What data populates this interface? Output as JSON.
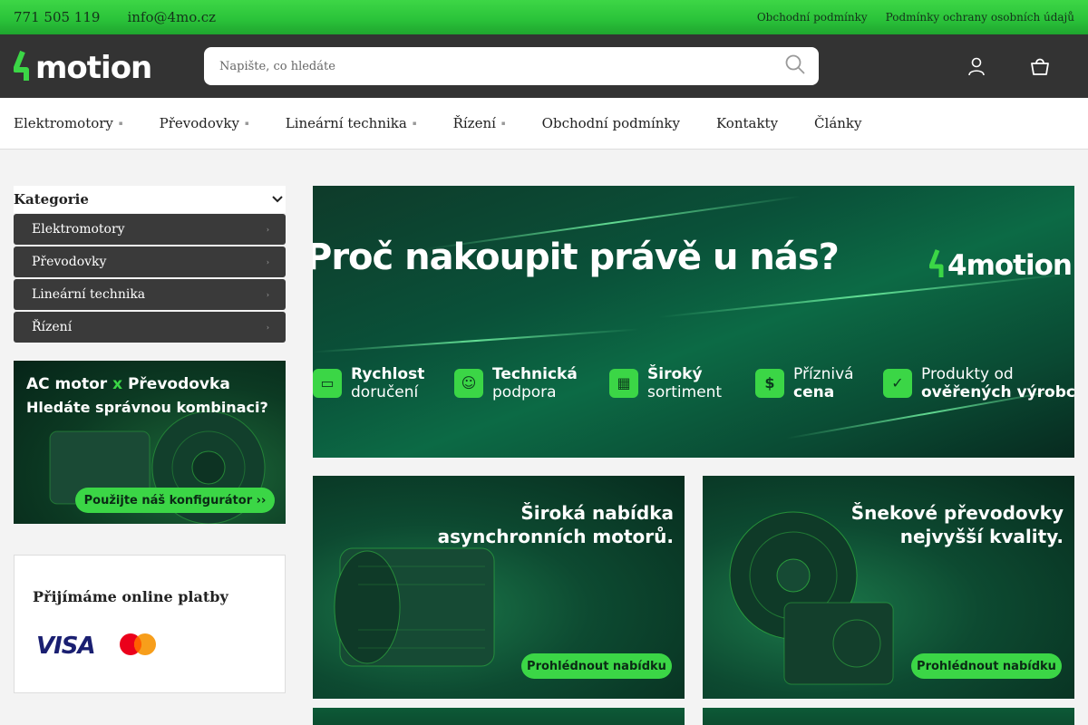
{
  "topbar": {
    "phone": "771 505 119",
    "email": "info@4mo.cz",
    "links": [
      "Obchodní podmínky",
      "Podmínky ochrany osobních údajů"
    ]
  },
  "header": {
    "logo_text": "4motion",
    "search": {
      "placeholder": "Napište, co hledáte",
      "icon": "search-icon"
    },
    "icons": [
      "user-icon",
      "cart-icon"
    ]
  },
  "nav": {
    "items": [
      {
        "label": "Elektromotory",
        "has_submenu": true
      },
      {
        "label": "Převodovky",
        "has_submenu": true
      },
      {
        "label": "Lineární technika",
        "has_submenu": true
      },
      {
        "label": "Řízení",
        "has_submenu": true
      },
      {
        "label": "Obchodní podmínky",
        "has_submenu": false
      },
      {
        "label": "Kontakty",
        "has_submenu": false
      },
      {
        "label": "Články",
        "has_submenu": false
      }
    ]
  },
  "sidebar": {
    "categories_title": "Kategorie",
    "categories": [
      {
        "label": "Elektromotory"
      },
      {
        "label": "Převodovky"
      },
      {
        "label": "Lineární technika"
      },
      {
        "label": "Řízení"
      }
    ],
    "configurator_banner": {
      "title_a": "AC motor",
      "title_x": "x",
      "title_b": "Převodovka",
      "subtitle": "Hledáte správnou kombinaci?",
      "button": "Použijte náš konfigurátor ››"
    },
    "payments": {
      "title": "Přijímáme online platby",
      "visa": "VISA"
    }
  },
  "hero": {
    "title": "Proč nakoupit právě u nás?",
    "logo_text": "4motion",
    "features": [
      {
        "line1": "Rychlost",
        "line2": "doručení",
        "bold": "line1",
        "icon": "truck-icon"
      },
      {
        "line1": "Technická",
        "line2": "podpora",
        "bold": "line1",
        "icon": "support-icon"
      },
      {
        "line1": "Široký",
        "line2": "sortiment",
        "bold": "line1",
        "icon": "boxes-icon"
      },
      {
        "line1": "Příznivá",
        "line2": "cena",
        "bold": "line2",
        "icon": "price-icon"
      },
      {
        "line1": "Produkty od",
        "line2": "ověřených výrobců",
        "bold": "line2",
        "icon": "certified-icon"
      }
    ]
  },
  "promo": [
    {
      "line1": "Široká nabídka",
      "line2": "asynchronních motorů.",
      "button": "Prohlédnout nabídku"
    },
    {
      "line1": "Šnekové převodovky",
      "line2": "nejvyšší kvality.",
      "button": "Prohlédnout nabídku"
    }
  ],
  "colors": {
    "accent": "#3bd646",
    "header_bg": "#333333",
    "dark_green": "#0a4a33"
  }
}
